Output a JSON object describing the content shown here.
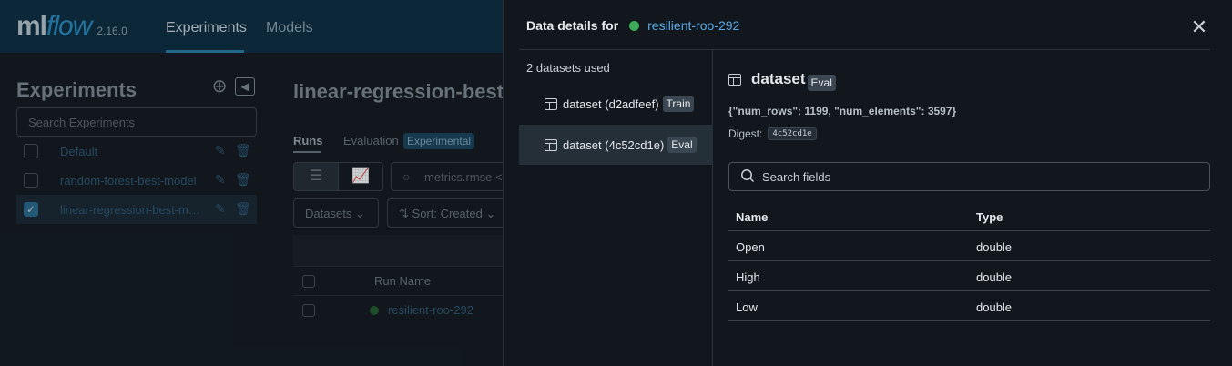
{
  "app": {
    "logo_ml": "ml",
    "logo_flow": "flow",
    "version": "2.16.0",
    "nav": [
      "Experiments",
      "Models"
    ]
  },
  "sidebar": {
    "title": "Experiments",
    "search_placeholder": "Search Experiments",
    "experiments": [
      {
        "name": "Default",
        "checked": false
      },
      {
        "name": "random-forest-best-model",
        "checked": false
      },
      {
        "name": "linear-regression-best-model",
        "checked": true
      }
    ]
  },
  "main": {
    "title": "linear-regression-best-model",
    "tabs": [
      "Runs",
      "Evaluation"
    ],
    "experimental_badge": "Experimental",
    "search_placeholder": "metrics.rmse <",
    "datasets_dropdown": "Datasets",
    "sort_dropdown": "Sort: Created",
    "column_run_name": "Run Name",
    "run_name": "resilient-roo-292"
  },
  "drawer": {
    "title_prefix": "Data details for",
    "run_name": "resilient-roo-292",
    "datasets_count": "2 datasets used",
    "datasets": [
      {
        "label": "dataset (d2adfeef)",
        "tag": "Train"
      },
      {
        "label": "dataset (4c52cd1e)",
        "tag": "Eval"
      }
    ],
    "detail": {
      "name": "dataset",
      "tag": "Eval",
      "profile": "{\"num_rows\": 1199, \"num_elements\": 3597}",
      "digest_label": "Digest:",
      "digest": "4c52cd1e",
      "search_placeholder": "Search fields",
      "columns": [
        "Name",
        "Type"
      ],
      "rows": [
        {
          "name": "Open",
          "type": "double"
        },
        {
          "name": "High",
          "type": "double"
        },
        {
          "name": "Low",
          "type": "double"
        }
      ]
    }
  },
  "colors": {
    "accent_link": "#5aa9e6",
    "run_status_green": "#3caa57",
    "topbar": "#0f3145"
  }
}
